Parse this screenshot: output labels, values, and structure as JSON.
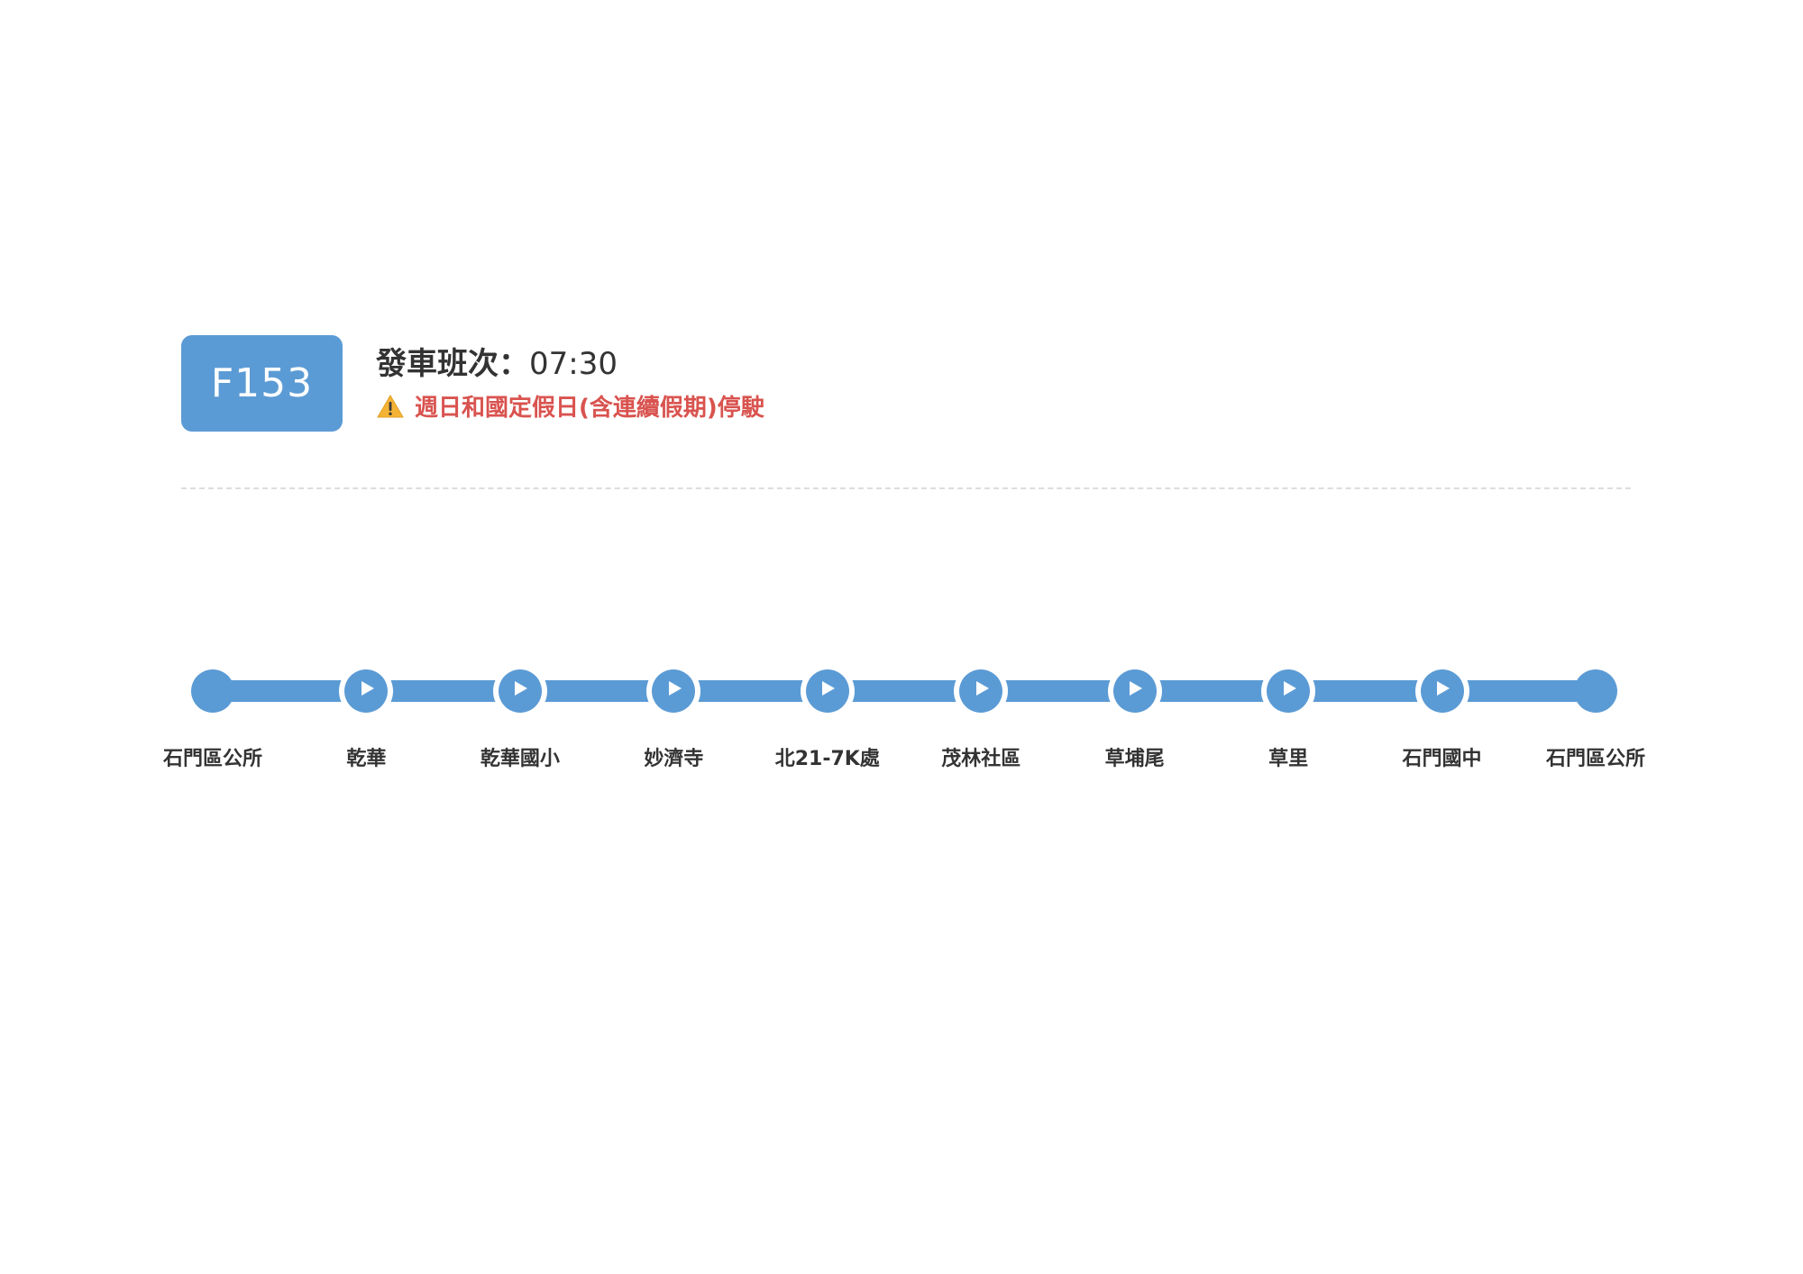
{
  "route": {
    "code": "F153",
    "color": "#5b9bd5"
  },
  "schedule": {
    "label": "發車班次：",
    "time": "07:30"
  },
  "notice": {
    "icon": "warning-icon",
    "text": "週日和國定假日(含連續假期)停駛",
    "color": "#d9534f"
  },
  "stops": [
    {
      "name": "石門區公所",
      "type": "terminal"
    },
    {
      "name": "乾華",
      "type": "intermediate"
    },
    {
      "name": "乾華國小",
      "type": "intermediate"
    },
    {
      "name": "妙濟寺",
      "type": "intermediate"
    },
    {
      "name": "北21-7K處",
      "type": "intermediate"
    },
    {
      "name": "茂林社區",
      "type": "intermediate"
    },
    {
      "name": "草埔尾",
      "type": "intermediate"
    },
    {
      "name": "草里",
      "type": "intermediate"
    },
    {
      "name": "石門國中",
      "type": "intermediate"
    },
    {
      "name": "石門區公所",
      "type": "terminal"
    }
  ]
}
